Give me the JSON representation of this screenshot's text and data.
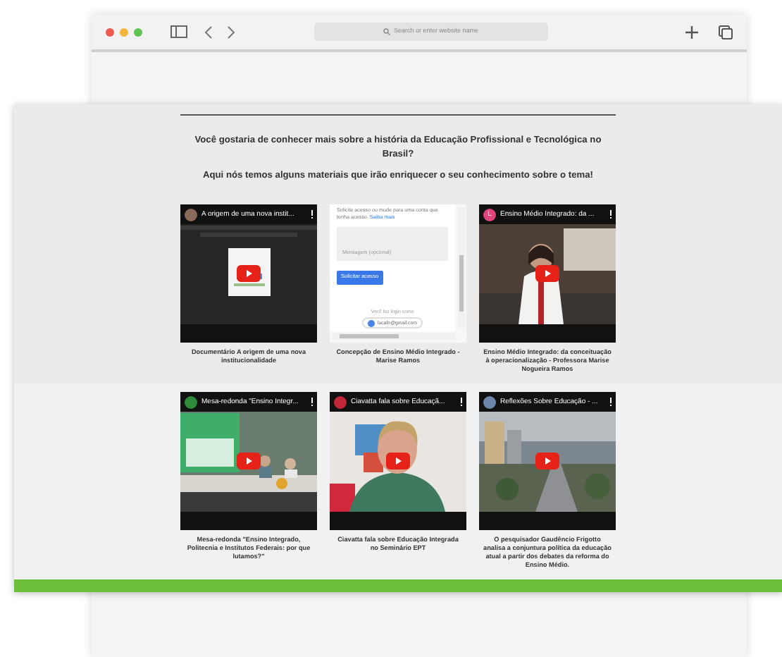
{
  "browser": {
    "address_placeholder": "Search or enter website name"
  },
  "page": {
    "heading": "Você gostaria de conhecer mais sobre a história da Educação Profissional e Tecnológica  no Brasil?",
    "subheading": "Aqui nós temos alguns materiais que irão enriquecer o seu conhecimento sobre o tema!",
    "items": [
      {
        "kind": "video",
        "title": "A origem de uma nova instit...",
        "color": "#8a6a5a",
        "caption": "Documentário A origem de uma nova institucionalidade"
      },
      {
        "kind": "document",
        "notice": "Solicite acesso ou mude para uma conta que tenha acesso.",
        "link": "Saiba mais",
        "message_placeholder": "Mensagem (opcional)",
        "button": "Solicitar acesso",
        "login_label": "Você fez login como",
        "email": "lucafo@gmail.com",
        "caption": "Concepção de Ensino Médio Integrado - Marise Ramos"
      },
      {
        "kind": "video",
        "title": "Ensino Médio Integrado: da ...",
        "color": "#e0457b",
        "avatar_letter": "L",
        "caption": "Ensino Médio Integrado: da conceituação à operacionalização - Professora Marise Nogueira Ramos"
      },
      {
        "kind": "video",
        "title": "Mesa-redonda \"Ensino Integr...",
        "color": "#2e8b3a",
        "caption": "Mesa-redonda \"Ensino Integrado, Politecnia e Institutos Federais: por que lutamos?\""
      },
      {
        "kind": "video",
        "title": "Ciavatta fala sobre Educaçã...",
        "color": "#c0283a",
        "caption": "Ciavatta fala sobre Educação Integrada no Seminário EPT"
      },
      {
        "kind": "video",
        "title": "Reflexões Sobre Educação - ...",
        "color": "#6b86a8",
        "caption": "O pesquisador Gaudêncio Frigotto analisa a conjuntura política da educação atual a partir dos debates da reforma do Ensino Médio."
      }
    ]
  }
}
